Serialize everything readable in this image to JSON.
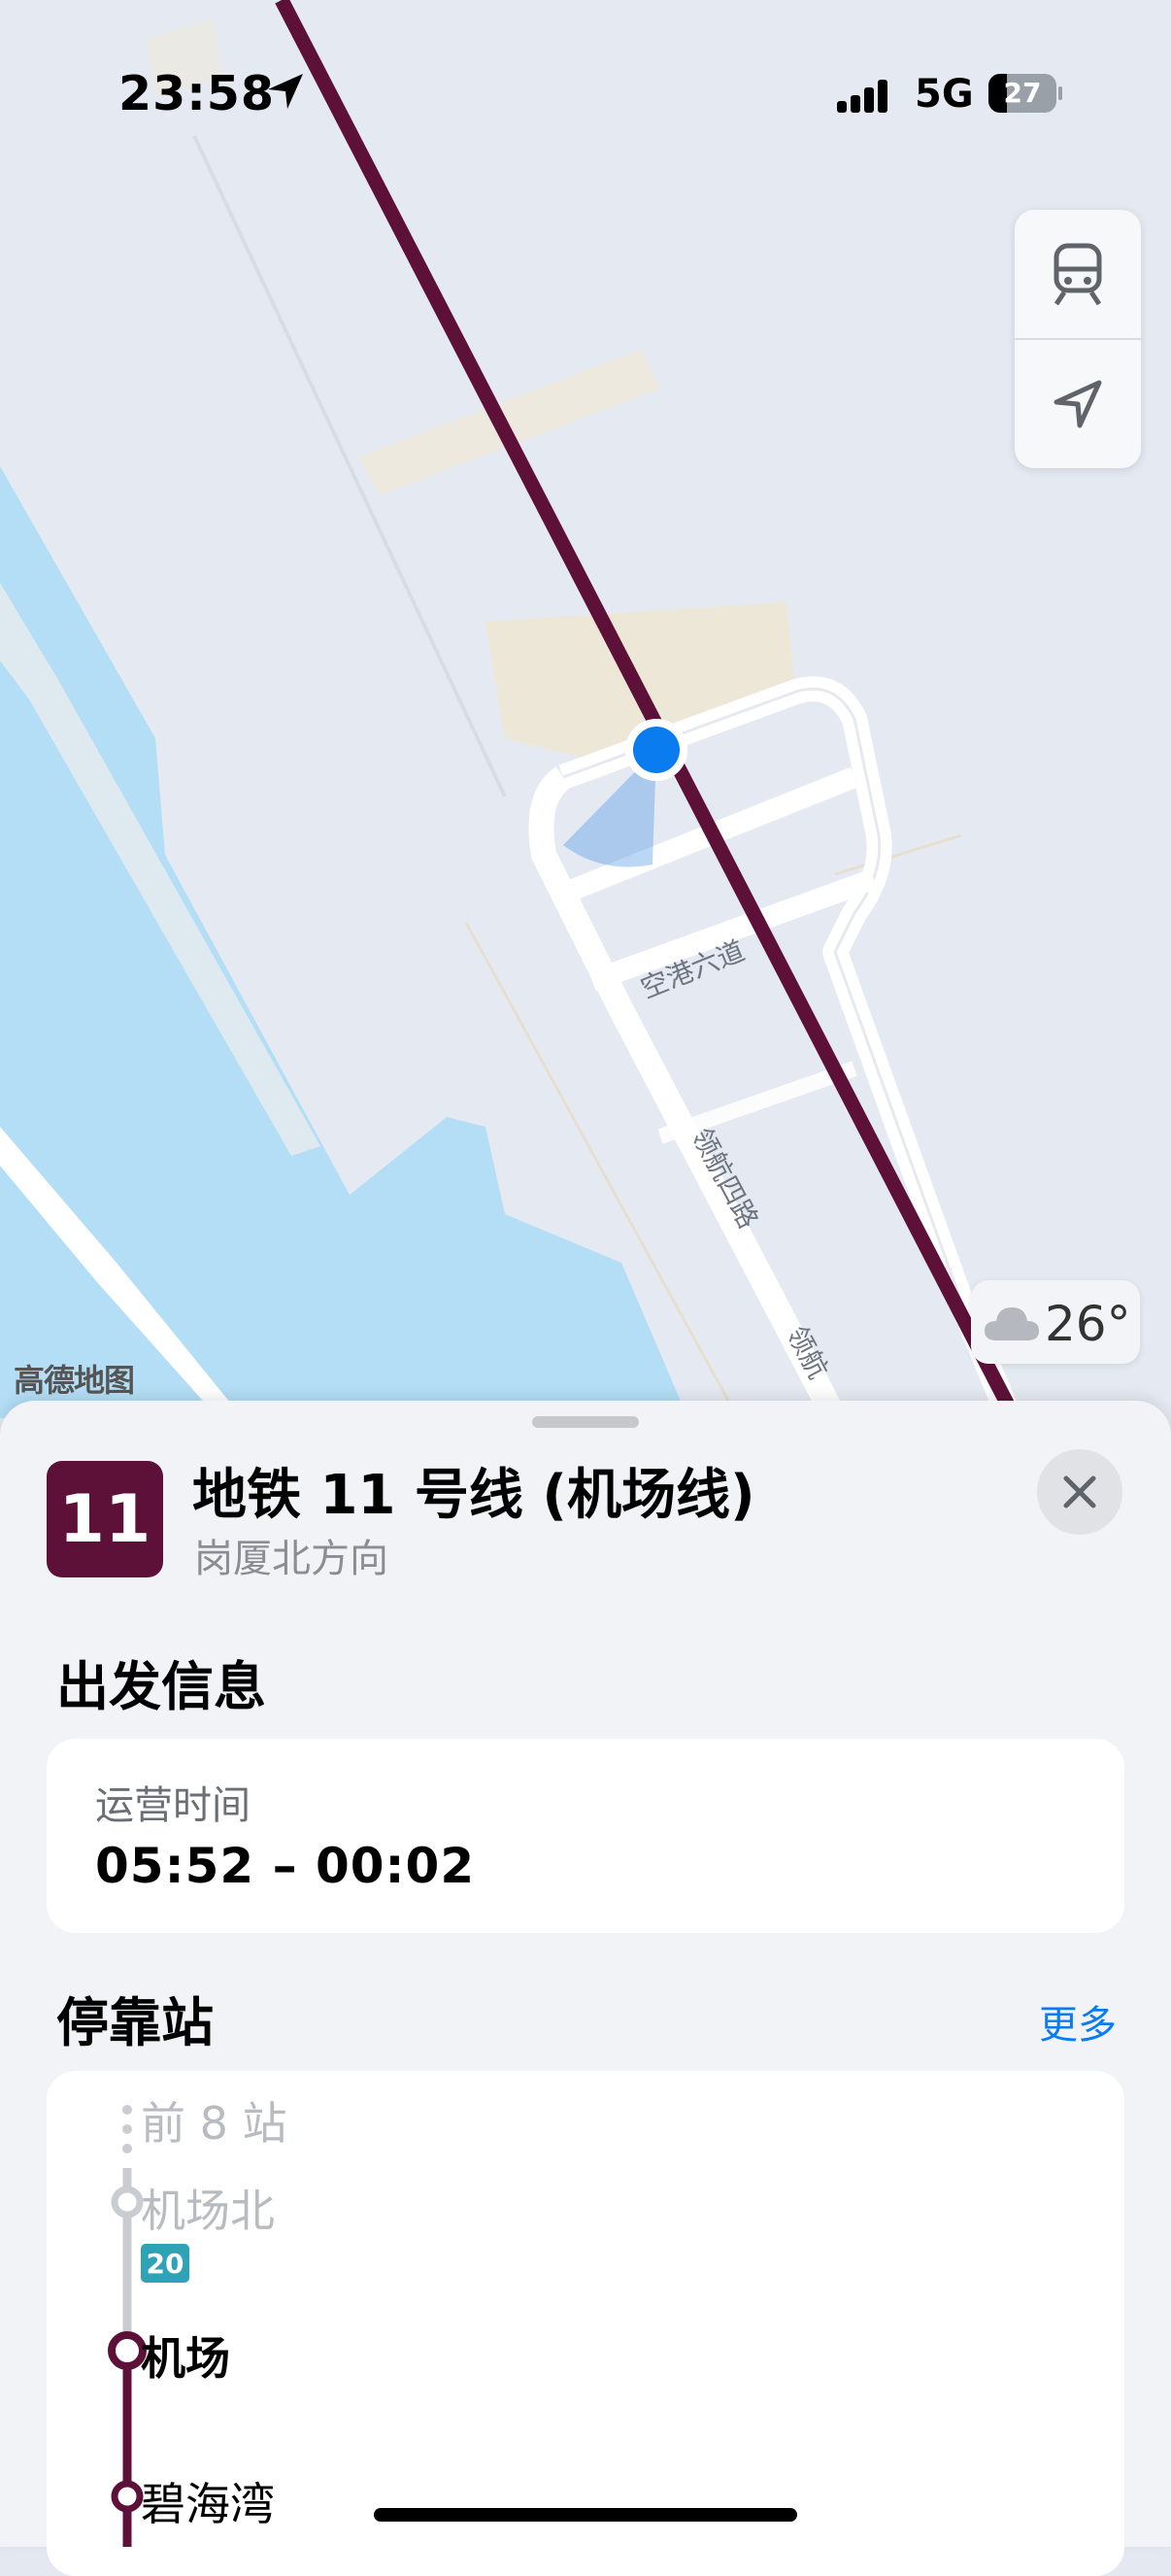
{
  "status_bar": {
    "time": "23:58",
    "network": "5G",
    "battery": "27"
  },
  "map": {
    "road_labels": [
      "空港六道",
      "领航四路",
      "领航"
    ],
    "provider_label": "高德地图",
    "weather": {
      "temperature": "26°",
      "icon": "cloud-icon"
    },
    "controls": [
      {
        "icon": "train-icon"
      },
      {
        "icon": "location-arrow-icon"
      }
    ],
    "line_color": "#5d1138"
  },
  "sheet": {
    "line_number": "11",
    "line_name": "地铁 11 号线 (机场线)",
    "direction": "岗厦北方向",
    "departure_title": "出发信息",
    "hours_label": "运营时间",
    "hours_value": "05:52 – 00:02",
    "stops_title": "停靠站",
    "more_label": "更多",
    "stops": [
      {
        "name": "前 8 站",
        "state": "previous"
      },
      {
        "name": "机场北",
        "state": "passed",
        "transfer": "20"
      },
      {
        "name": "机场",
        "state": "current"
      },
      {
        "name": "碧海湾",
        "state": "upcoming"
      }
    ],
    "transfer_color": "#2ea3b5"
  }
}
